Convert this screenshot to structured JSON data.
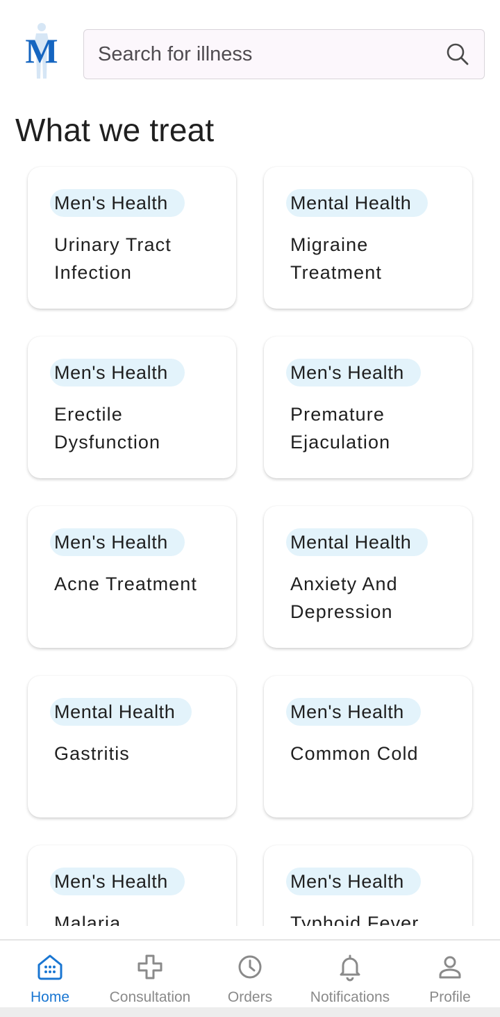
{
  "header": {
    "logo_letter": "M",
    "search_placeholder": "Search for illness"
  },
  "section_title": "What we treat",
  "cards": [
    {
      "tag": "Men's Health",
      "title": "Urinary Tract Infection"
    },
    {
      "tag": "Mental Health",
      "title": "Migraine Treatment"
    },
    {
      "tag": "Men's Health",
      "title": "Erectile Dysfunction"
    },
    {
      "tag": "Men's Health",
      "title": "Premature Ejaculation"
    },
    {
      "tag": "Men's Health",
      "title": "Acne Treatment"
    },
    {
      "tag": "Mental Health",
      "title": "Anxiety And Depression"
    },
    {
      "tag": "Mental Health",
      "title": "Gastritis"
    },
    {
      "tag": "Men's Health",
      "title": "Common Cold"
    },
    {
      "tag": "Men's Health",
      "title": "Malaria"
    },
    {
      "tag": "Men's Health",
      "title": "Typhoid Fever"
    }
  ],
  "nav": {
    "active": "home",
    "items": [
      {
        "label": "Home",
        "icon": "home-icon"
      },
      {
        "label": "Consultation",
        "icon": "plus-cross-icon"
      },
      {
        "label": "Orders",
        "icon": "clock-icon"
      },
      {
        "label": "Notifications",
        "icon": "bell-icon"
      },
      {
        "label": "Profile",
        "icon": "person-icon"
      }
    ]
  },
  "colors": {
    "accent": "#1976d2",
    "logo_blue": "#1565c0",
    "tag_bg": "#e3f3fb",
    "nav_inactive": "#8a8a8a"
  }
}
